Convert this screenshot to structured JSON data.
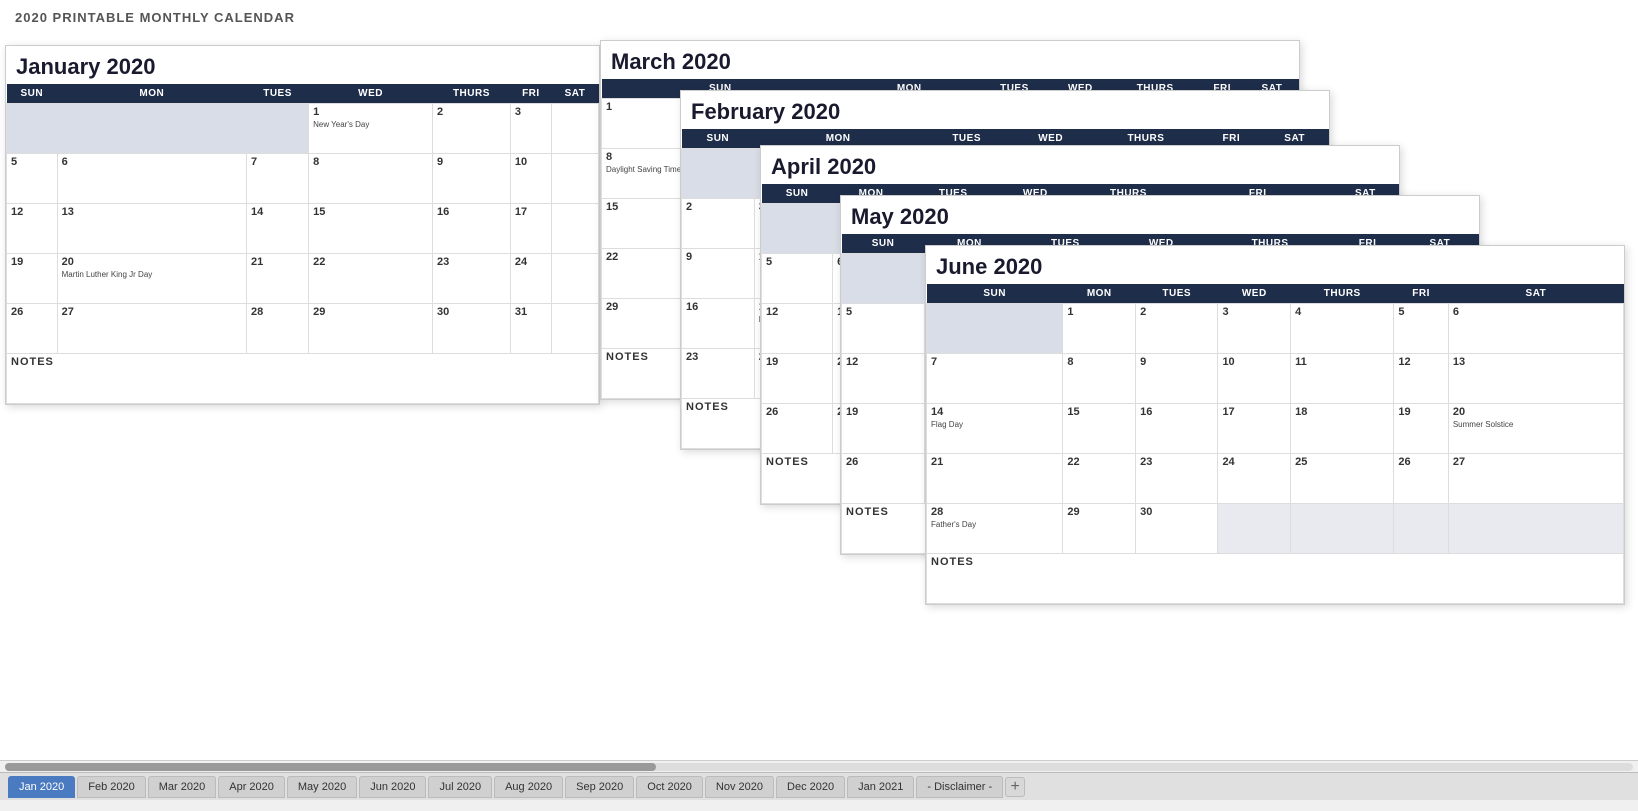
{
  "page": {
    "title": "2020 PRINTABLE MONTHLY CALENDAR"
  },
  "tabs": [
    {
      "label": "Jan 2020",
      "active": true
    },
    {
      "label": "Feb 2020",
      "active": false
    },
    {
      "label": "Mar 2020",
      "active": false
    },
    {
      "label": "Apr 2020",
      "active": false
    },
    {
      "label": "May 2020",
      "active": false
    },
    {
      "label": "Jun 2020",
      "active": false
    },
    {
      "label": "Jul 2020",
      "active": false
    },
    {
      "label": "Aug 2020",
      "active": false
    },
    {
      "label": "Sep 2020",
      "active": false
    },
    {
      "label": "Oct 2020",
      "active": false
    },
    {
      "label": "Nov 2020",
      "active": false
    },
    {
      "label": "Dec 2020",
      "active": false
    },
    {
      "label": "Jan 2021",
      "active": false
    },
    {
      "label": "- Disclaimer -",
      "active": false
    }
  ],
  "calendars": {
    "january": {
      "title": "January 2020",
      "days_header": [
        "SUN",
        "MON",
        "TUES",
        "WED",
        "THURS",
        "FRI",
        "SAT"
      ]
    },
    "march": {
      "title": "March 2020",
      "days_header": [
        "SUN",
        "MON",
        "TUES",
        "WED",
        "THURS",
        "FRI",
        "SAT"
      ]
    },
    "february": {
      "title": "February 2020",
      "days_header": [
        "SUN",
        "MON",
        "TUES",
        "WED",
        "THURS",
        "FRI",
        "SAT"
      ]
    },
    "april": {
      "title": "April 2020",
      "days_header": [
        "SUN",
        "MON",
        "TUES",
        "WED",
        "THURS",
        "FRI",
        "SAT"
      ]
    },
    "may": {
      "title": "May 2020",
      "days_header": [
        "SUN",
        "MON",
        "TUES",
        "WED",
        "THURS",
        "FRI",
        "SAT"
      ]
    },
    "june": {
      "title": "June 2020",
      "days_header": [
        "SUN",
        "MON",
        "TUES",
        "WED",
        "THURS",
        "FRI",
        "SAT"
      ]
    }
  },
  "notes_label": "NOTES"
}
